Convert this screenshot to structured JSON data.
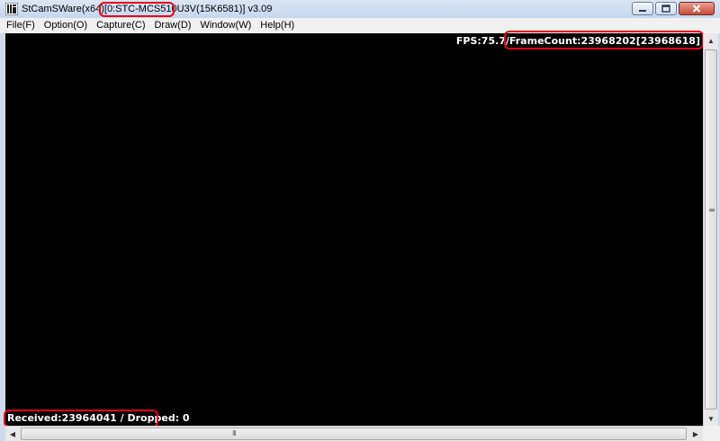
{
  "window": {
    "title_prefix": "StCamSWare(x64)[0:",
    "title_camera": "STC-MCS510U3V",
    "title_suffix": "(15K6581)] v3.09",
    "minimize_icon": "minimize-icon",
    "maximize_icon": "maximize-icon",
    "close_icon": "close-icon"
  },
  "menu": {
    "items": [
      {
        "label": "File(F)"
      },
      {
        "label": "Option(O)"
      },
      {
        "label": "Capture(C)"
      },
      {
        "label": "Draw(D)"
      },
      {
        "label": "Window(W)"
      },
      {
        "label": "Help(H)"
      }
    ]
  },
  "viewport": {
    "background": "#000000",
    "fps_text": "FPS:75.7/FrameCount:23968202[23968618]",
    "received_text": "Received:23964041 / Dropped: 0"
  },
  "annotation_color": "#e8001a"
}
